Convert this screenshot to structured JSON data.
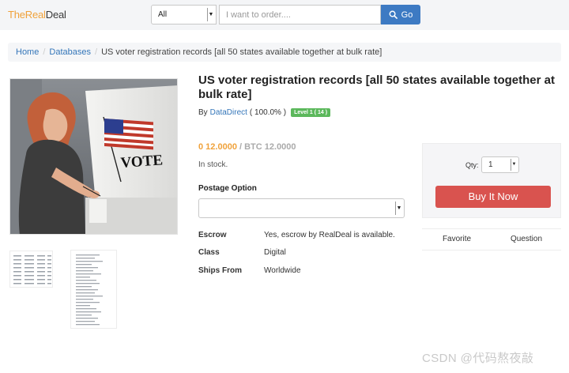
{
  "header": {
    "logo_part1": "TheReal",
    "logo_part2": "Deal",
    "category_value": "All",
    "search_placeholder": "I want to order....",
    "go_label": "Go"
  },
  "breadcrumb": {
    "home": "Home",
    "section": "Databases",
    "current": "US voter registration records [all 50 states available together at bulk rate]"
  },
  "listing": {
    "title": "US voter registration records [all 50 states available together at bulk rate]",
    "by_label": "By",
    "seller_name": "DataDirect",
    "seller_rating": "( 100.0% )",
    "seller_level": "Level 1 ( 14 )",
    "price_primary": "0 12.0000",
    "price_btc": "/ BTC 12.0000",
    "stock_status": "In stock.",
    "postage_label": "Postage Option",
    "specs": [
      {
        "label": "Escrow",
        "value": "Yes, escrow by RealDeal is available."
      },
      {
        "label": "Class",
        "value": "Digital"
      },
      {
        "label": "Ships From",
        "value": "Worldwide"
      }
    ],
    "photo_sign_text": "VOTE"
  },
  "buybox": {
    "qty_label": "Qty:",
    "qty_value": "1",
    "buy_label": "Buy It Now",
    "favorite_label": "Favorite",
    "question_label": "Question"
  },
  "watermark": "CSDN @代码熬夜敲",
  "colors": {
    "accent_blue": "#3d7ac3",
    "link_blue": "#3476b9",
    "orange": "#f0a23b",
    "buy_red": "#d9534f",
    "level_green": "#5cb85c"
  }
}
